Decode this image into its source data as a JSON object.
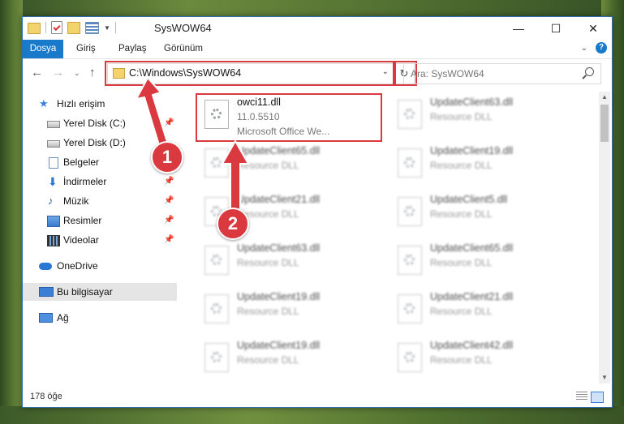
{
  "window": {
    "title": "SysWOW64",
    "controls": {
      "minimize": "—",
      "maximize": "☐",
      "close": "✕"
    }
  },
  "ribbon": {
    "tabs": [
      "Dosya",
      "Giriş",
      "Paylaş",
      "Görünüm"
    ],
    "help": "?"
  },
  "address": {
    "path": "C:\\Windows\\SysWOW64",
    "search_placeholder": "Ara: SysWOW64"
  },
  "sidebar": {
    "items": [
      {
        "label": "Hızlı erişim",
        "icon": "star-icon",
        "pinned": false
      },
      {
        "label": "Yerel Disk (C:)",
        "icon": "disk-icon",
        "pinned": true
      },
      {
        "label": "Yerel Disk (D:)",
        "icon": "disk-icon",
        "pinned": false
      },
      {
        "label": "Belgeler",
        "icon": "documents-icon",
        "pinned": true
      },
      {
        "label": "İndirmeler",
        "icon": "download-icon",
        "pinned": true
      },
      {
        "label": "Müzik",
        "icon": "music-icon",
        "pinned": true
      },
      {
        "label": "Resimler",
        "icon": "pictures-icon",
        "pinned": true
      },
      {
        "label": "Videolar",
        "icon": "videos-icon",
        "pinned": true
      },
      {
        "label": "OneDrive",
        "icon": "cloud-icon",
        "pinned": false
      },
      {
        "label": "Bu bilgisayar",
        "icon": "pc-icon",
        "pinned": false,
        "selected": true
      },
      {
        "label": "Ağ",
        "icon": "network-icon",
        "pinned": false
      }
    ]
  },
  "files": [
    {
      "name": "owci11.dll",
      "line2": "11.0.5510",
      "line3": "Microsoft Office We...",
      "highlighted": true
    },
    {
      "name": "UpdateClient63.dll",
      "line2": "Resource DLL"
    },
    {
      "name": "UpdateClient65.dll",
      "line2": "Resource DLL"
    },
    {
      "name": "UpdateClient19.dll",
      "line2": "Resource DLL"
    },
    {
      "name": "UpdateClient21.dll",
      "line2": "Resource DLL"
    },
    {
      "name": "UpdateClient5.dll",
      "line2": "Resource DLL"
    },
    {
      "name": "UpdateClient63.dll",
      "line2": "Resource DLL"
    },
    {
      "name": "UpdateClient65.dll",
      "line2": "Resource DLL"
    },
    {
      "name": "UpdateClient19.dll",
      "line2": "Resource DLL"
    },
    {
      "name": "UpdateClient21.dll",
      "line2": "Resource DLL"
    },
    {
      "name": "UpdateClient19.dll",
      "line2": "Resource DLL"
    },
    {
      "name": "UpdateClient42.dll",
      "line2": "Resource DLL"
    }
  ],
  "status": {
    "item_count": "178 öğe"
  },
  "callouts": {
    "one": "1",
    "two": "2"
  },
  "colors": {
    "accent": "#1979ca",
    "highlight": "#d9393f"
  }
}
